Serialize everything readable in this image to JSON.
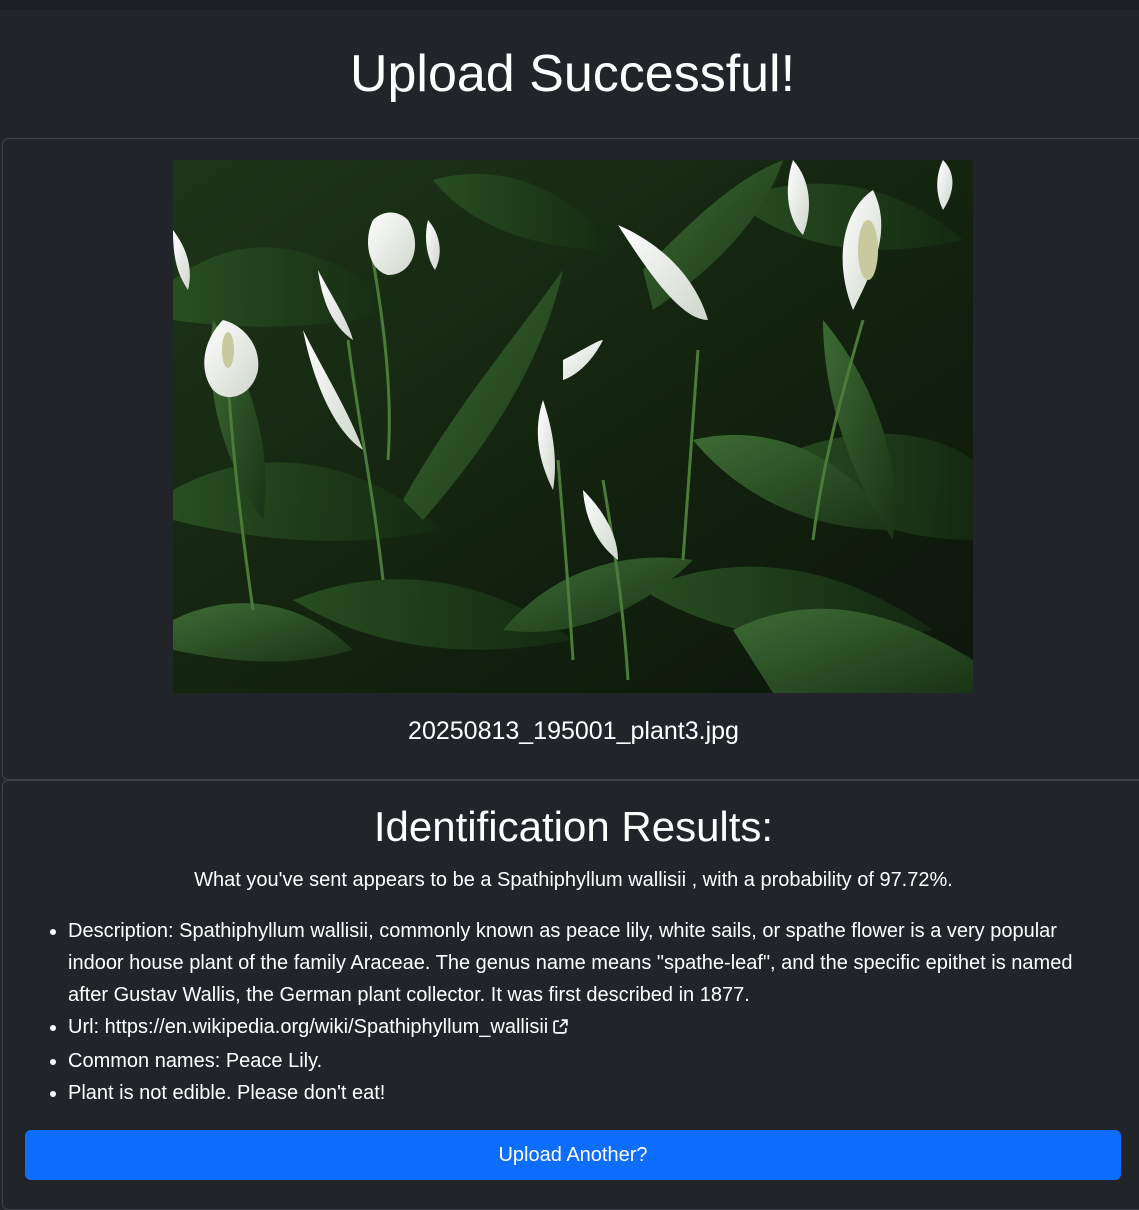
{
  "page": {
    "title": "Upload Successful!"
  },
  "upload": {
    "filename": "20250813_195001_plant3.jpg"
  },
  "results": {
    "heading": "Identification Results:",
    "summary": "What you've sent appears to be a Spathiphyllum wallisii , with a probability of 97.72%.",
    "description": "Description: Spathiphyllum wallisii, commonly known as peace lily, white sails, or spathe flower is a very popular indoor house plant of the family Araceae. The genus name means \"spathe-leaf\", and the specific epithet is named after Gustav Wallis, the German plant collector. It was first described in 1877.",
    "url_label": "Url: ",
    "url": "https://en.wikipedia.org/wiki/Spathiphyllum_wallisii",
    "common_names": "Common names: Peace Lily.",
    "edibility": "Plant is not edible. Please don't eat!"
  },
  "actions": {
    "upload_another": "Upload Another?"
  },
  "colors": {
    "background": "#212529",
    "accent": "#0d6efd"
  },
  "icons": {
    "external_link": "external-link-icon"
  }
}
